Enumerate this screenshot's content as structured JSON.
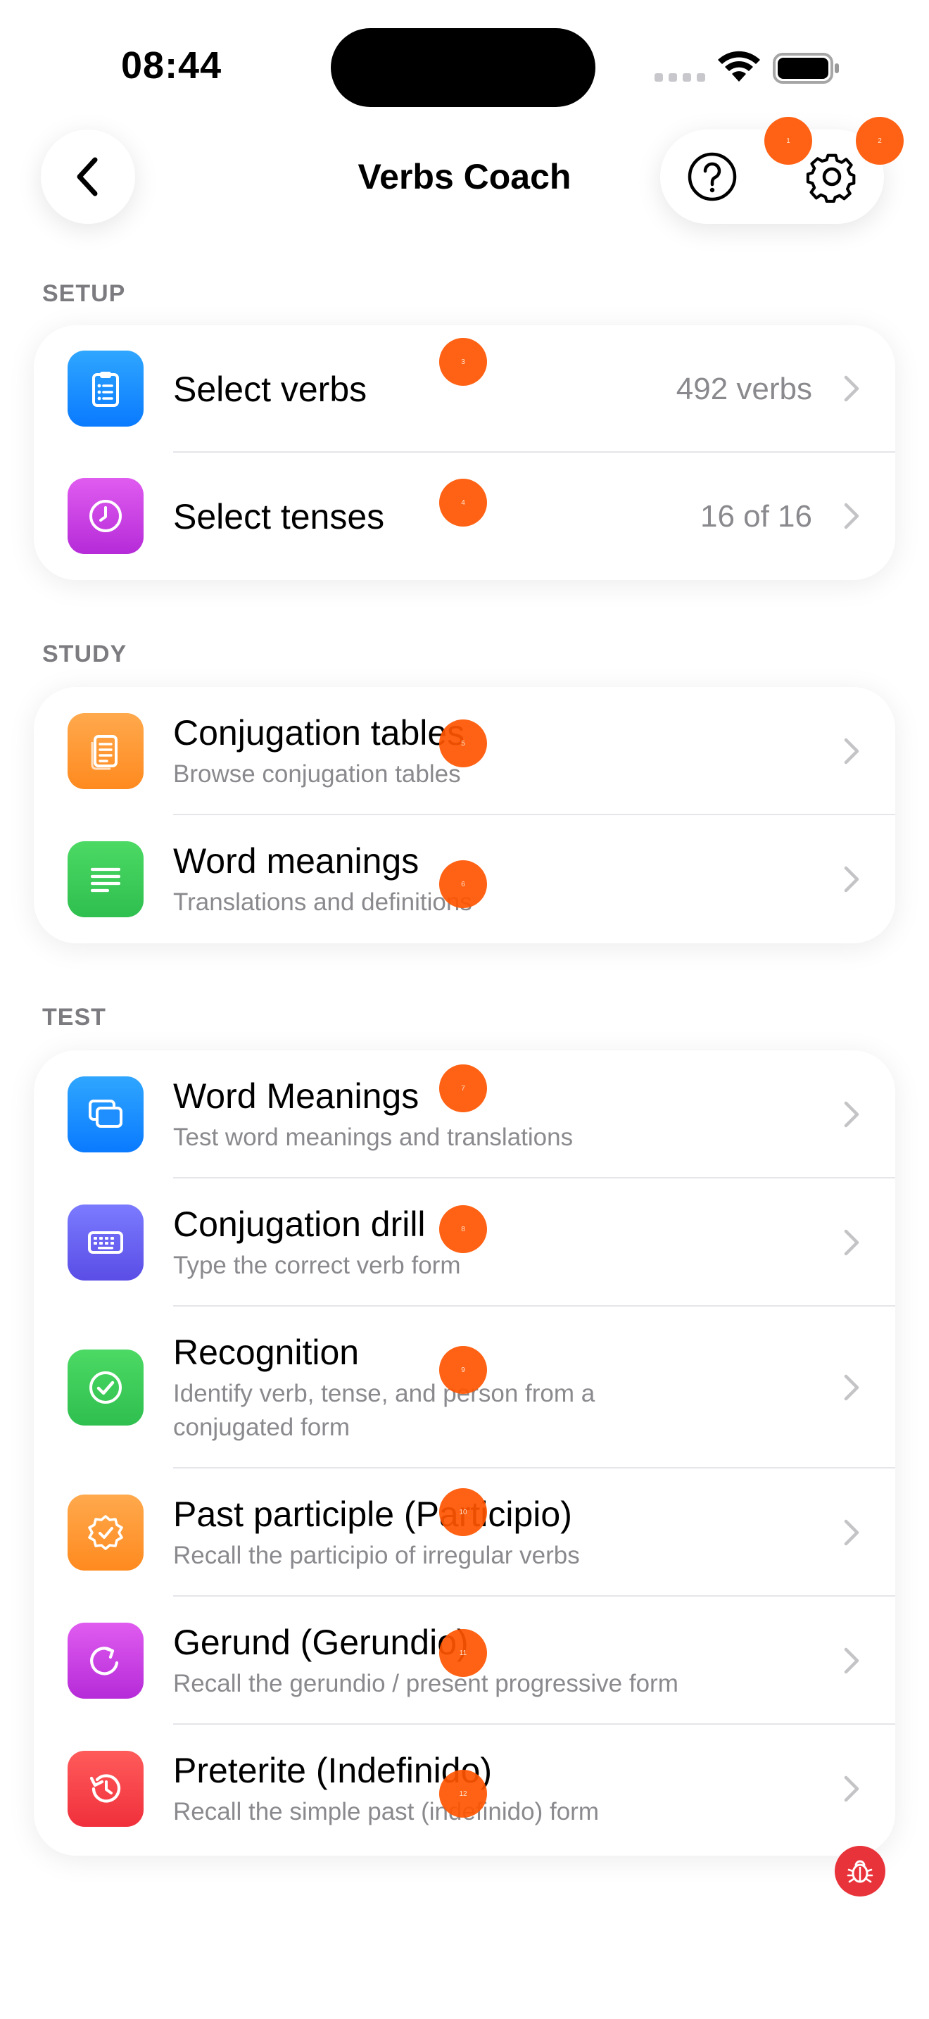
{
  "status_bar": {
    "time": "08:44"
  },
  "nav": {
    "title": "Verbs Coach"
  },
  "setup": {
    "header": "SETUP",
    "rows": [
      {
        "title": "Select verbs",
        "value": "492 verbs",
        "icon": "clipboard-list-icon"
      },
      {
        "title": "Select tenses",
        "value": "16 of 16",
        "icon": "clock-icon"
      }
    ]
  },
  "study": {
    "header": "STUDY",
    "rows": [
      {
        "title": "Conjugation tables",
        "subtitle": "Browse conjugation tables",
        "icon": "document-icon"
      },
      {
        "title": "Word meanings",
        "subtitle": "Translations and definitions",
        "icon": "text-lines-icon"
      }
    ]
  },
  "test": {
    "header": "TEST",
    "rows": [
      {
        "title": "Word Meanings",
        "subtitle": "Test word meanings and translations",
        "icon": "cards-icon"
      },
      {
        "title": "Conjugation drill",
        "subtitle": "Type the correct verb form",
        "icon": "keyboard-icon"
      },
      {
        "title": "Recognition",
        "subtitle": "Identify verb, tense, and person from a conjugated form",
        "icon": "checkmark-circle-icon"
      },
      {
        "title": "Past participle (Participio)",
        "subtitle": "Recall the participio of irregular verbs",
        "icon": "seal-check-icon"
      },
      {
        "title": "Gerund (Gerundio)",
        "subtitle": "Recall the gerundio / present progressive form",
        "icon": "arrow-clockwise-icon"
      },
      {
        "title": "Preterite (Indefinido)",
        "subtitle": "Recall the simple past (indefinido) form",
        "icon": "history-icon"
      }
    ]
  },
  "markers": [
    "1",
    "2",
    "3",
    "4",
    "5",
    "6",
    "7",
    "8",
    "9",
    "10",
    "11",
    "12"
  ],
  "colors": {
    "marker": "#ff5500",
    "section_header": "#7c7c80",
    "secondary_text": "#8a8a8e"
  }
}
